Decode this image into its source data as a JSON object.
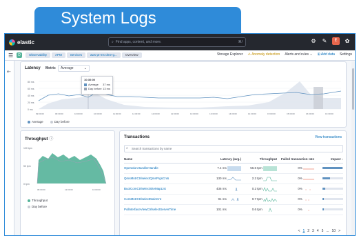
{
  "banner": {
    "title": "System Logs"
  },
  "topbar": {
    "logo_text": "elastic",
    "search_placeholder": "Find apps, content, and more.",
    "search_shortcut": "⌘/",
    "avatar": "E"
  },
  "subbar": {
    "space_badge": "D",
    "breadcrumbs": [
      "Observability",
      "APM",
      "Services",
      "aws-pt-ms-dme-g...",
      "Overview"
    ],
    "storage_explorer": "Storage Explorer",
    "anomaly_detection": "Anomaly detection",
    "alerts_rules": "Alerts and rules",
    "add_data": "Add data",
    "settings": "Settings"
  },
  "latency": {
    "title": "Latency",
    "metric_label": "Metric",
    "metric_value": "Average",
    "y_ticks": [
      "80 ms",
      "60 ms",
      "40 ms",
      "20 ms",
      "0 ms"
    ],
    "x_ticks": [
      "09:00:00",
      "09:30:00",
      "10:00:00",
      "10:30:00",
      "11:00:00",
      "11:30:00",
      "12:00:00",
      "12:30:00",
      "13:00:00",
      "13:30:00",
      "14:00:00",
      "14:30:00",
      "15:00:00",
      "15:30:00",
      "16:00:00",
      "16:30:00"
    ],
    "tooltip": {
      "time": "10:30:00",
      "average_label": "Average",
      "average_value": "37 ms",
      "day_before_label": "Day before",
      "day_before_value": "13 ms"
    },
    "legend": [
      "Average",
      "Day before"
    ]
  },
  "throughput": {
    "title": "Throughput",
    "y_ticks": [
      "100 tpm",
      "50 tpm",
      "0 tpm"
    ],
    "x_ticks": [
      "08:00:00",
      "12:00:00",
      "16:00:00"
    ],
    "legend": [
      "Throughput",
      "Day before"
    ]
  },
  "transactions": {
    "title": "Transactions",
    "view_link": "View transactions",
    "search_placeholder": "Search transactions by name",
    "columns": [
      "Name",
      "Latency (avg.)",
      "Throughput",
      "Failed transaction rate",
      "Impact"
    ],
    "rows": [
      {
        "name": "OperationHandlerHandle",
        "latency": "7.4 ms",
        "throughput": "56.6 tpm",
        "failed": "0%",
        "impact": 0.95
      },
      {
        "name": "QmsMntrCtrlselectQmsPrgsCnts",
        "latency": "130 ms",
        "throughput": "2.2 tpm",
        "failed": "0%",
        "impact": 0.35
      },
      {
        "name": "BuoiComCtrlselectSiteMapList",
        "latency": "436 ms",
        "throughput": "0.2 tpm",
        "failed": "0%",
        "impact": 0.12
      },
      {
        "name": "ComMntrCtrlselectMainCnt",
        "latency": "91 ms",
        "throughput": "0.7 tpm",
        "failed": "0%",
        "impact": 0.08
      },
      {
        "name": "PollnterfaceViewCtrlselectServerTime",
        "latency": "101 ms",
        "throughput": "0.6 tpm",
        "failed": "0%",
        "impact": 0.06
      }
    ],
    "pager": [
      "<",
      "1",
      "2",
      "3",
      "4",
      "5",
      "...",
      "10",
      ">"
    ]
  },
  "colors": {
    "banner": "#2f8bd9",
    "series_average": "#6092c0",
    "series_day_before": "#98a2b3",
    "throughput_green": "#54b399",
    "link": "#006bb8"
  }
}
